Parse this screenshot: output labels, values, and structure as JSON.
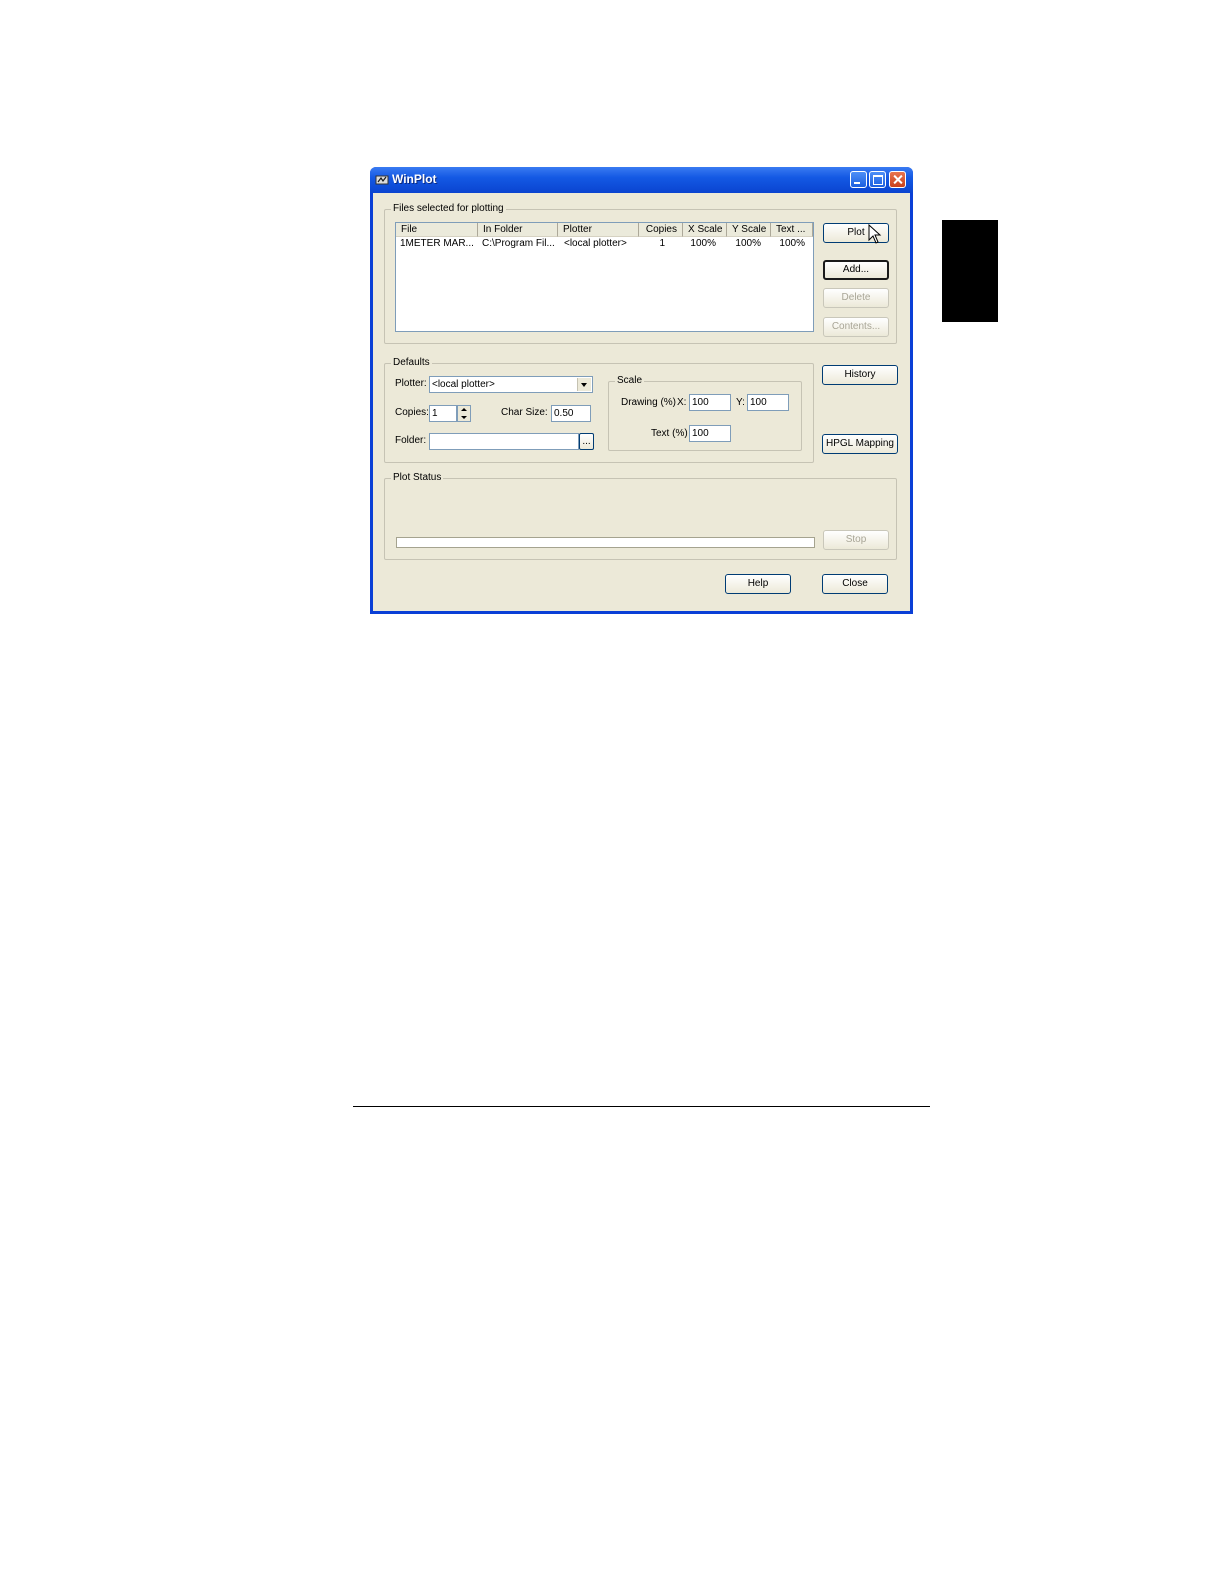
{
  "window": {
    "title": "WinPlot"
  },
  "files_group": {
    "label": "Files selected for plotting",
    "columns": [
      "File",
      "In Folder",
      "Plotter",
      "Copies",
      "X Scale",
      "Y Scale",
      "Text ..."
    ],
    "rows": [
      [
        "1METER MAR...",
        "C:\\Program Fil...",
        "<local plotter>",
        "1",
        "100%",
        "100%",
        "100%"
      ]
    ]
  },
  "buttons": {
    "plot": "Plot",
    "add": "Add...",
    "delete": "Delete",
    "contents": "Contents...",
    "history": "History",
    "hpgl_mapping": "HPGL Mapping",
    "stop": "Stop",
    "help": "Help",
    "close": "Close",
    "browse": "..."
  },
  "defaults": {
    "label": "Defaults",
    "plotter_label": "Plotter:",
    "plotter_value": "<local plotter>",
    "copies_label": "Copies:",
    "copies_value": "1",
    "char_size_label": "Char Size:",
    "char_size_value": "0.50",
    "folder_label": "Folder:",
    "folder_value": ""
  },
  "scale": {
    "label": "Scale",
    "drawing_label": "Drawing (%)",
    "x_label": "X:",
    "x_value": "100",
    "y_label": "Y:",
    "y_value": "100",
    "text_label": "Text (%)",
    "text_value": "100"
  },
  "plot_status": {
    "label": "Plot Status"
  }
}
